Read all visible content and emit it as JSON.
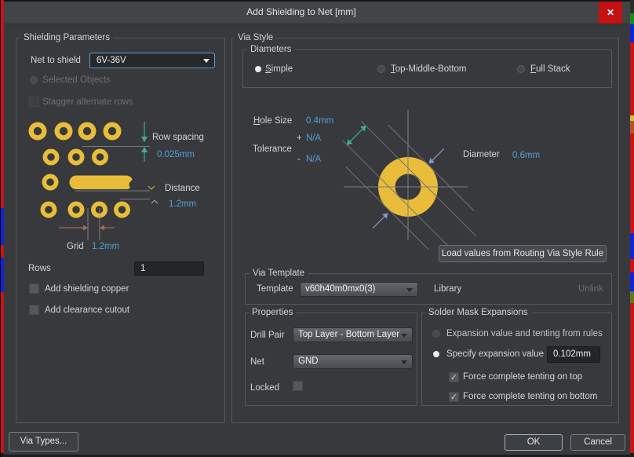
{
  "window": {
    "title": "Add Shielding to Net [mm]"
  },
  "icons": {
    "close": "✕",
    "check": "✓"
  },
  "shielding": {
    "group_label": "Shielding Parameters",
    "net_to_shield_label": "Net to shield",
    "net_value": "6V-36V",
    "selected_objects_label": "Selected Objects",
    "stagger_label": "Stagger alternate rows",
    "diagram": {
      "row_spacing_label": "Row spacing",
      "row_spacing_value": "0.025mm",
      "distance_label": "Distance",
      "distance_value": "1.2mm",
      "grid_label": "Grid",
      "grid_value": "1.2mm"
    },
    "rows_label": "Rows",
    "rows_value": "1",
    "add_copper_label": "Add shielding copper",
    "add_cutout_label": "Add clearance cutout"
  },
  "via_style": {
    "group_label": "Via Style",
    "diameters": {
      "group_label": "Diameters",
      "options": [
        {
          "label": "Simple",
          "selected": true
        },
        {
          "label": "Top-Middle-Bottom",
          "selected": false
        },
        {
          "label": "Full Stack",
          "selected": false
        }
      ]
    },
    "preview": {
      "hole_size_label": "Hole Size",
      "hole_size_value": "0.4mm",
      "tolerance_label": "Tolerance",
      "tolerance_plus_sign": "+",
      "tolerance_plus_value": "N/A",
      "tolerance_minus_sign": "-",
      "tolerance_minus_value": "N/A",
      "diameter_label": "Diameter",
      "diameter_value": "0.6mm"
    },
    "load_button_label": "Load values from Routing Via Style Rule",
    "via_template": {
      "group_label": "Via Template",
      "template_label": "Template",
      "template_value": "v60h40m0mx0(3)",
      "library_label": "Library",
      "unlink_label": "Unlink"
    },
    "properties": {
      "group_label": "Properties",
      "drill_pair_label": "Drill Pair",
      "drill_pair_value": "Top Layer - Bottom Layer",
      "net_label": "Net",
      "net_value": "GND",
      "locked_label": "Locked"
    },
    "solder_mask": {
      "group_label": "Solder Mask Expansions",
      "option_rules": "Expansion value and tenting from rules",
      "option_specify": "Specify expansion value",
      "expansion_value": "0.102mm",
      "tenting_top": "Force complete tenting on top",
      "tenting_bottom": "Force complete tenting on bottom"
    }
  },
  "footer": {
    "via_types_label": "Via Types...",
    "ok_label": "OK",
    "cancel_label": "Cancel"
  }
}
